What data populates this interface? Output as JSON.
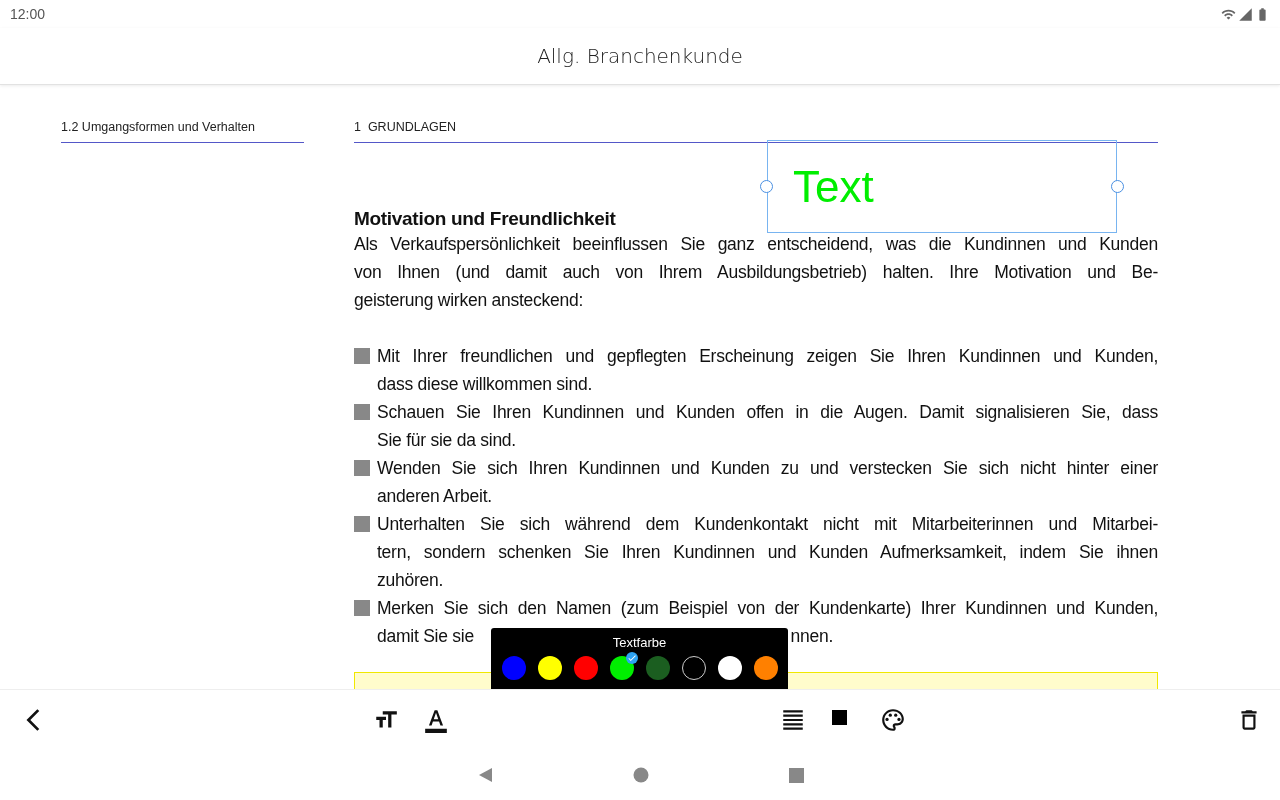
{
  "status_bar": {
    "time": "12:00"
  },
  "app_bar": {
    "title": "Allg. Branchenkunde"
  },
  "page": {
    "left_header": "1.2 Umgangsformen und Verhalten",
    "right_header": "1  GRUNDLAGEN",
    "heading": "Motivation und Freundlichkeit",
    "intro_lines": [
      "Als Verkaufspersönlichkeit beeinflussen Sie ganz entscheidend, was die Kundinnen und Kunden",
      "von Ihnen (und damit auch von Ihrem Ausbildungsbetrieb) halten. Ihre Motivation und Be-",
      "geisterung wirken ansteckend:"
    ],
    "bullets": [
      {
        "lines": [
          "Mit Ihrer freundlichen und gepflegten Erscheinung zeigen Sie Ihren Kundinnen und Kunden,",
          "dass diese willkommen sind."
        ]
      },
      {
        "lines": [
          "Schauen Sie Ihren Kundinnen und Kunden offen in die Augen. Damit signalisieren Sie, dass",
          "Sie für sie da sind."
        ]
      },
      {
        "lines": [
          "Wenden Sie sich Ihren Kundinnen und Kunden zu und verstecken Sie sich nicht hinter einer",
          "anderen Arbeit."
        ]
      },
      {
        "lines": [
          "Unterhalten Sie sich während dem Kundenkontakt nicht mit Mitarbeiterinnen und Mitarbei-",
          "tern, sondern schenken Sie Ihren Kundinnen und Kunden Aufmerksamkeit, indem Sie ihnen",
          "zuhören."
        ]
      },
      {
        "lines": [
          "Merken Sie sich den Namen (zum Beispiel von der Kundenkarte) Ihrer Kundinnen und Kunden,"
        ],
        "partial_line": [
          "damit Sie sie",
          "nnen."
        ]
      }
    ],
    "text_annotation": {
      "text": "Text",
      "color": "#00ee00"
    }
  },
  "color_popup": {
    "title": "Textfarbe",
    "colors": [
      {
        "color": "#0000ff",
        "selected": false
      },
      {
        "color": "#ffff00",
        "selected": false
      },
      {
        "color": "#ff0000",
        "selected": false
      },
      {
        "color": "#00ee00",
        "selected": true
      },
      {
        "color": "#1b5e20",
        "selected": false
      },
      {
        "color": "#000000",
        "selected": false
      },
      {
        "color": "#ffffff",
        "selected": false
      },
      {
        "color": "#ff8000",
        "selected": false
      }
    ]
  }
}
